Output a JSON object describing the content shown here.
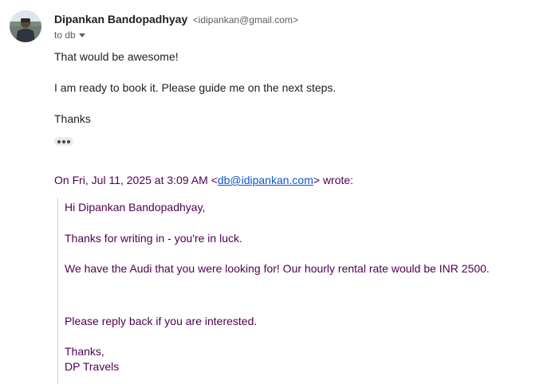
{
  "sender": {
    "name": "Dipankan Bandopadhyay",
    "email": "<idipankan@gmail.com>",
    "recipients_label": "to db"
  },
  "message": {
    "line1": "That would be awesome!",
    "line2": "I am ready to book it. Please guide me on the next steps.",
    "line3": "Thanks"
  },
  "quoted": {
    "attribution_prefix": "On Fri, Jul 11, 2025 at 3:09 AM <",
    "attribution_email": "db@idipankan.com",
    "attribution_suffix": "> wrote:",
    "greeting": "Hi Dipankan Bandopadhyay,",
    "line1": "Thanks for writing in - you're in luck.",
    "line2": "We have the Audi that you were looking for! Our hourly rental rate would be INR 2500.",
    "line3": "Please reply back if you are interested.",
    "signoff": "Thanks,",
    "signature": "DP Travels"
  },
  "icons": {
    "avatar": "avatar",
    "recipients_caret": "caret-down-icon",
    "show_trimmed": "more-horiz-icon"
  },
  "colors": {
    "quoted_text": "#500050",
    "link": "#1155cc"
  }
}
